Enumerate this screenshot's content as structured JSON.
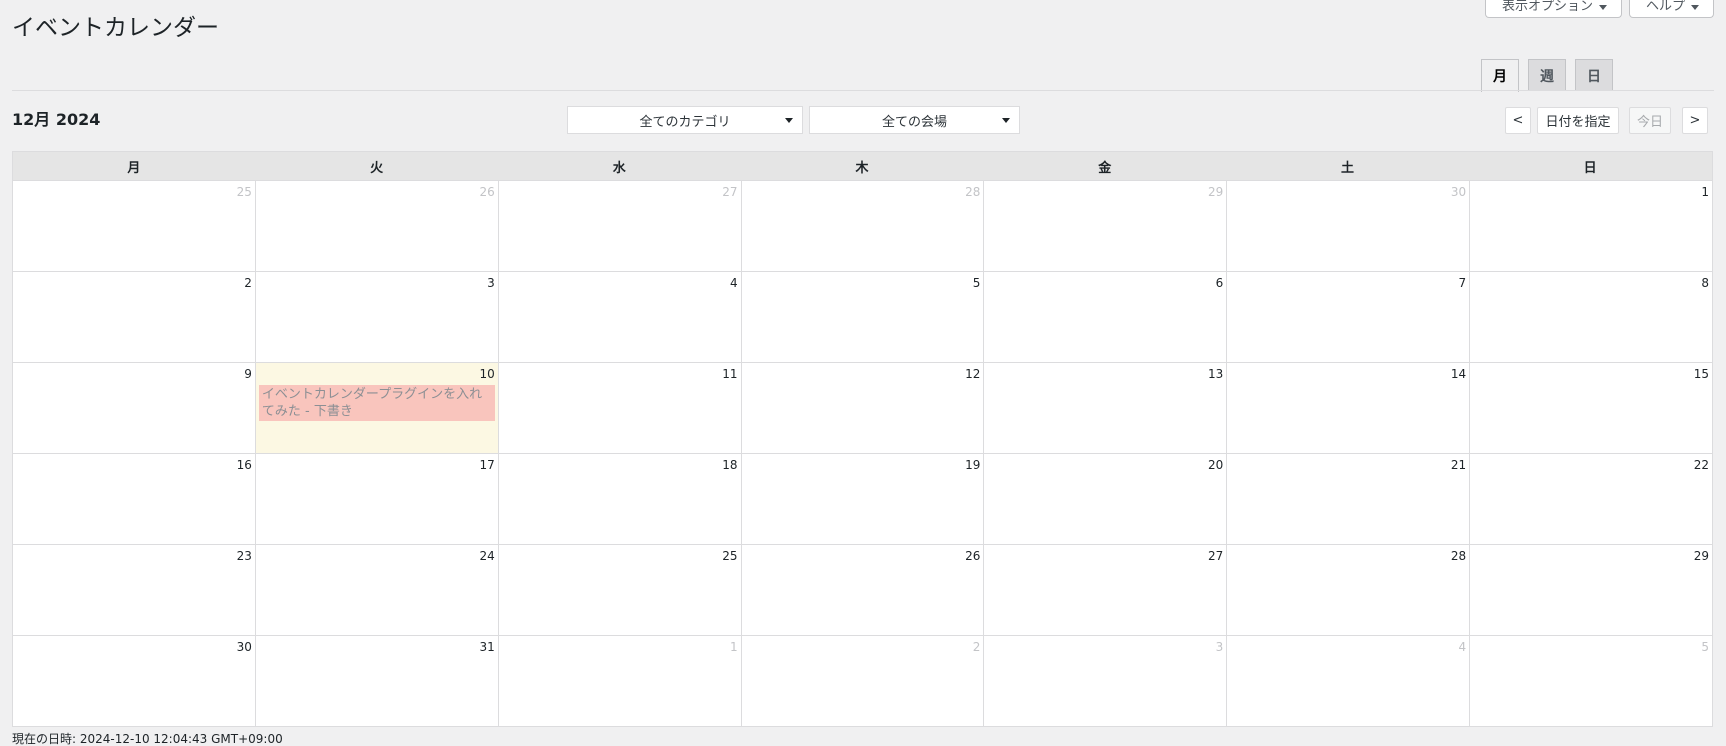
{
  "page": {
    "title": "イベントカレンダー"
  },
  "screen_tabs": {
    "options_label": "表示オプション",
    "help_label": "ヘルプ"
  },
  "view_tabs": [
    {
      "label": "月",
      "active": true
    },
    {
      "label": "週",
      "active": false
    },
    {
      "label": "日",
      "active": false
    }
  ],
  "toolbar": {
    "month_title": "12月 2024",
    "category_select": "全てのカテゴリ",
    "venue_select": "全ての会場",
    "prev_label": "<",
    "goto_date_label": "日付を指定",
    "today_label": "今日",
    "next_label": ">"
  },
  "calendar": {
    "day_headers": [
      "月",
      "火",
      "水",
      "木",
      "金",
      "土",
      "日"
    ],
    "weeks": [
      [
        {
          "n": "25",
          "o": true
        },
        {
          "n": "26",
          "o": true
        },
        {
          "n": "27",
          "o": true
        },
        {
          "n": "28",
          "o": true
        },
        {
          "n": "29",
          "o": true
        },
        {
          "n": "30",
          "o": true
        },
        {
          "n": "1"
        }
      ],
      [
        {
          "n": "2"
        },
        {
          "n": "3"
        },
        {
          "n": "4"
        },
        {
          "n": "5"
        },
        {
          "n": "6"
        },
        {
          "n": "7"
        },
        {
          "n": "8"
        }
      ],
      [
        {
          "n": "9"
        },
        {
          "n": "10",
          "today": true,
          "event": "イベントカレンダープラグインを入れてみた - 下書き"
        },
        {
          "n": "11"
        },
        {
          "n": "12"
        },
        {
          "n": "13"
        },
        {
          "n": "14"
        },
        {
          "n": "15"
        }
      ],
      [
        {
          "n": "16"
        },
        {
          "n": "17"
        },
        {
          "n": "18"
        },
        {
          "n": "19"
        },
        {
          "n": "20"
        },
        {
          "n": "21"
        },
        {
          "n": "22"
        }
      ],
      [
        {
          "n": "23"
        },
        {
          "n": "24"
        },
        {
          "n": "25"
        },
        {
          "n": "26"
        },
        {
          "n": "27"
        },
        {
          "n": "28"
        },
        {
          "n": "29"
        }
      ],
      [
        {
          "n": "30"
        },
        {
          "n": "31"
        },
        {
          "n": "1",
          "o": true
        },
        {
          "n": "2",
          "o": true
        },
        {
          "n": "3",
          "o": true
        },
        {
          "n": "4",
          "o": true
        },
        {
          "n": "5",
          "o": true
        }
      ]
    ]
  },
  "footer": {
    "current_time": "現在の日時: 2024-12-10 12:04:43 GMT+09:00"
  },
  "colors": {
    "today_bg": "#fcf8e3",
    "event_bg": "#f9c5bd"
  }
}
